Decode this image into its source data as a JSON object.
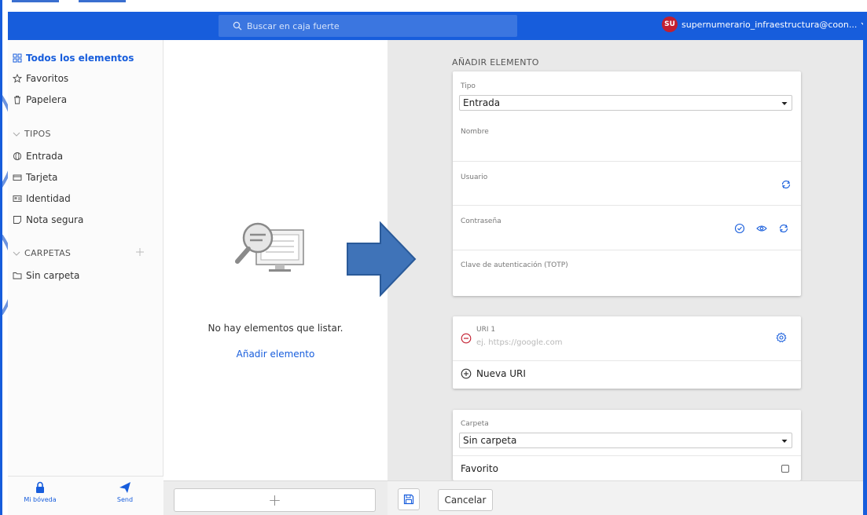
{
  "header": {
    "search_placeholder": "Buscar en caja fuerte",
    "account_initials": "SU",
    "account_email": "supernumerario_infraestructura@coon..."
  },
  "sidebar": {
    "all_items": "Todos los elementos",
    "favorites": "Favoritos",
    "trash": "Papelera",
    "types_heading": "TIPOS",
    "types": [
      "Entrada",
      "Tarjeta",
      "Identidad",
      "Nota segura"
    ],
    "folders_heading": "CARPETAS",
    "folders": [
      "Sin carpeta"
    ]
  },
  "bottom_nav": {
    "vault": "Mi bóveda",
    "send": "Send"
  },
  "list": {
    "empty_text": "No hay elementos que listar.",
    "add_link": "Añadir elemento",
    "add_button": "+"
  },
  "form": {
    "title": "AÑADIR ELEMENTO",
    "type_label": "Tipo",
    "type_value": "Entrada",
    "name_label": "Nombre",
    "username_label": "Usuario",
    "password_label": "Contraseña",
    "totp_label": "Clave de autenticación (TOTP)",
    "uri_label": "URI 1",
    "uri_placeholder": "ej. https://google.com",
    "new_uri": "Nueva URI",
    "folder_label": "Carpeta",
    "folder_value": "Sin carpeta",
    "favorite_label": "Favorito"
  },
  "footer": {
    "cancel": "Cancelar"
  },
  "colors": {
    "brand": "#175ddc",
    "danger": "#c31f30",
    "arrow": "#3f73b8"
  }
}
